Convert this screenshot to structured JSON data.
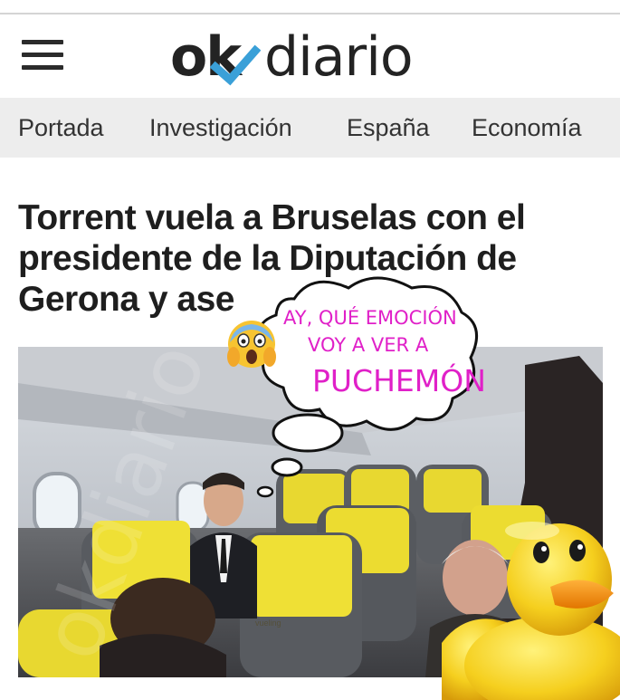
{
  "header": {
    "logo_ok": "ok",
    "logo_diario": "diario",
    "accent_color": "#3aa0d8"
  },
  "nav": {
    "items": [
      {
        "label": "Portada"
      },
      {
        "label": "Investigación"
      },
      {
        "label": "España"
      },
      {
        "label": "Economía"
      }
    ]
  },
  "article": {
    "headline_line1": "Torrent vuela a Bruselas con el",
    "headline_line2": "presidente de la Diputación de",
    "headline_line3": "Gerona y ase"
  },
  "overlay": {
    "bubble_line1": "AY, QUÉ EMOCIÓN",
    "bubble_line2": "VOY A VER A",
    "bubble_line3": "PUCHEMÓN",
    "bubble_text_color": "#e020c8",
    "emoji_name": "scream-emoji",
    "sticker_name": "rubber-duck-sticker"
  },
  "photo": {
    "watermark": "okdiario",
    "headrest_label": "vueling"
  }
}
